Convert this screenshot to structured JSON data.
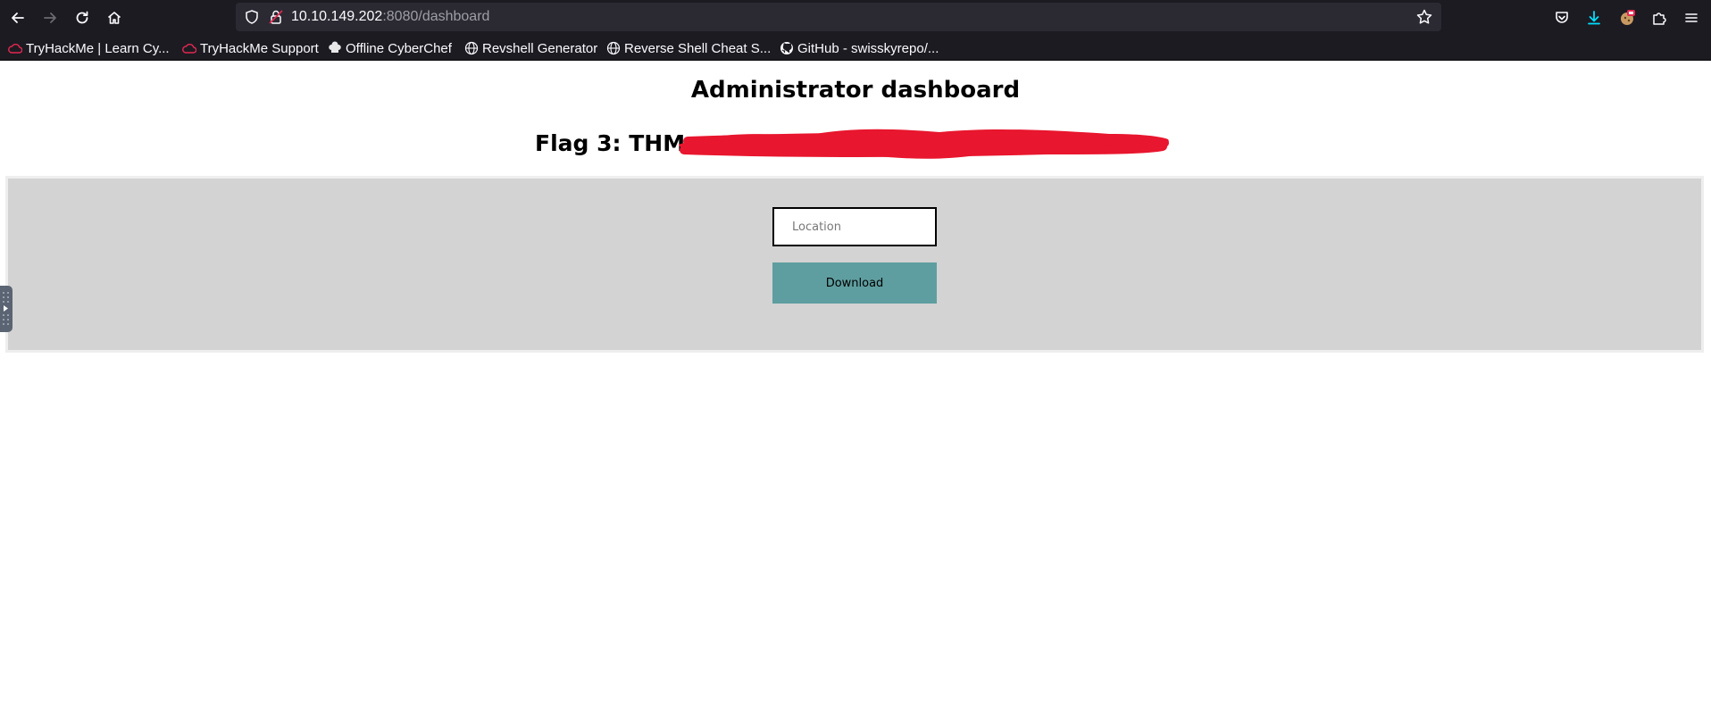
{
  "browser": {
    "url_host": "10.10.149.202",
    "url_rest": ":8080/dashboard",
    "bookmarks": [
      {
        "label": "TryHackMe | Learn Cy...",
        "icon": "tryhackme-icon"
      },
      {
        "label": "TryHackMe Support",
        "icon": "tryhackme-icon"
      },
      {
        "label": "Offline CyberChef",
        "icon": "chef-hat-icon"
      },
      {
        "label": "Revshell Generator",
        "icon": "globe-icon"
      },
      {
        "label": "Reverse Shell Cheat S...",
        "icon": "globe-icon"
      },
      {
        "label": "GitHub - swisskyrepo/...",
        "icon": "github-icon"
      }
    ]
  },
  "page": {
    "title": "Administrator dashboard",
    "flag_label": "Flag 3: THM"
  },
  "form": {
    "location_placeholder": "Location",
    "location_value": "",
    "download_label": "Download"
  },
  "colors": {
    "panel_bg": "#d3d3d3",
    "button_bg": "#5f9ea0",
    "redaction": "#e8162e"
  }
}
